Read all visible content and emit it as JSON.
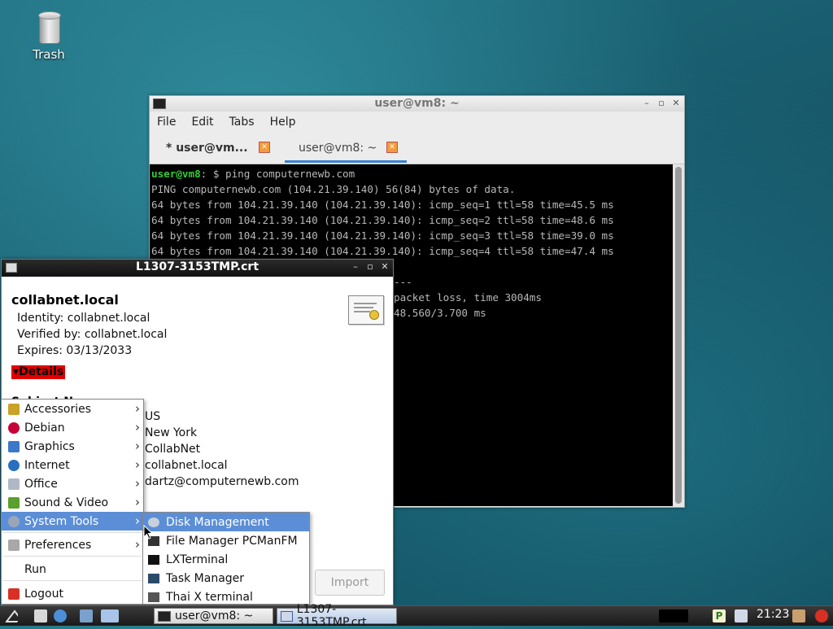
{
  "desktop": {
    "trash_label": "Trash"
  },
  "terminal": {
    "title": "user@vm8: ~",
    "menu": [
      "File",
      "Edit",
      "Tabs",
      "Help"
    ],
    "tabs": [
      {
        "label": "* user@vm..."
      },
      {
        "label": "user@vm8: ~"
      }
    ],
    "prompt_user": "user@vm8",
    "prompt_rest": ": $ ping computernewb.com",
    "lines": [
      "PING computernewb.com (104.21.39.140) 56(84) bytes of data.",
      "64 bytes from 104.21.39.140 (104.21.39.140): icmp_seq=1 ttl=58 time=45.5 ms",
      "64 bytes from 104.21.39.140 (104.21.39.140): icmp_seq=2 ttl=58 time=48.6 ms",
      "64 bytes from 104.21.39.140 (104.21.39.140): icmp_seq=3 ttl=58 time=39.0 ms",
      "64 bytes from 104.21.39.140 (104.21.39.140): icmp_seq=4 ttl=58 time=47.4 ms",
      "",
      "---",
      "packet loss, time 3004ms",
      "48.560/3.700 ms"
    ]
  },
  "cert": {
    "title": "L1307-3153TMP.crt",
    "name": "collabnet.local",
    "identity": "Identity: collabnet.local",
    "verified": "Verified by: collabnet.local",
    "expires": "Expires: 03/13/2033",
    "details_label": "Details",
    "subject_header": "Subject Name",
    "values": [
      "US",
      "New York",
      "CollabNet",
      "collabnet.local",
      "dartz@computernewb.com"
    ],
    "import_label": "Import"
  },
  "start_menu": {
    "items": [
      {
        "label": "Accessories",
        "icon": "accessories-icon",
        "color": "#c9a227"
      },
      {
        "label": "Debian",
        "icon": "debian-icon",
        "color": "#c70036"
      },
      {
        "label": "Graphics",
        "icon": "graphics-icon",
        "color": "#3c78c8"
      },
      {
        "label": "Internet",
        "icon": "internet-icon",
        "color": "#2a6fbf"
      },
      {
        "label": "Office",
        "icon": "office-icon",
        "color": "#b0b8c8"
      },
      {
        "label": "Sound & Video",
        "icon": "sound-video-icon",
        "color": "#5aa02c"
      },
      {
        "label": "System Tools",
        "icon": "system-tools-icon",
        "color": "#9aa6b8"
      },
      {
        "label": "Preferences",
        "icon": "preferences-icon",
        "color": "#a8a8a8"
      },
      {
        "label": "Run",
        "icon": "",
        "color": ""
      },
      {
        "label": "Logout",
        "icon": "logout-icon",
        "color": "#d93025"
      }
    ],
    "submenu": [
      {
        "label": "Disk Management",
        "icon": "disk-icon"
      },
      {
        "label": "File Manager PCManFM",
        "icon": "file-manager-icon"
      },
      {
        "label": "LXTerminal",
        "icon": "terminal-icon"
      },
      {
        "label": "Task Manager",
        "icon": "task-manager-icon"
      },
      {
        "label": "Thai X terminal",
        "icon": "thai-terminal-icon"
      }
    ]
  },
  "taskbar": {
    "tasks": [
      "user@vm8: ~",
      "L1307-3153TMP.crt"
    ],
    "clock": "21:23"
  }
}
